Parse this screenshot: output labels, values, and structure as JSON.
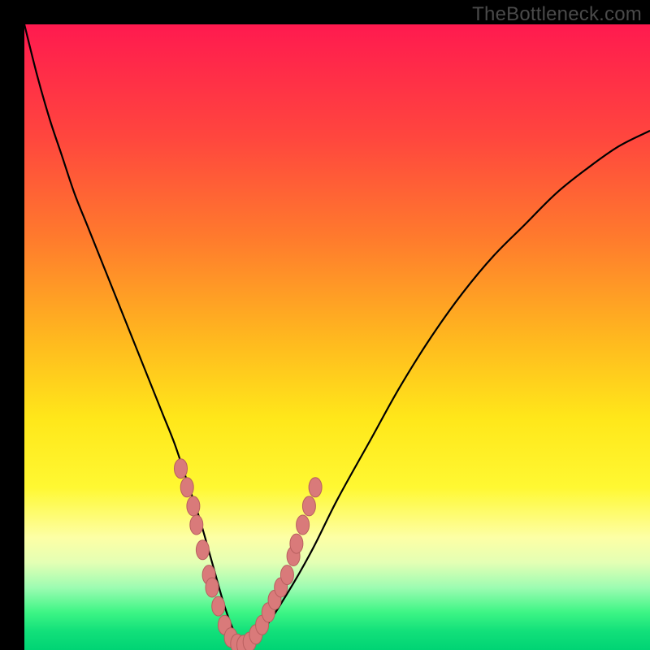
{
  "attribution": "TheBottleneck.com",
  "colors": {
    "frame": "#000000",
    "gradient_top": "#ff1a4f",
    "gradient_bottom": "#00d474",
    "curve_stroke": "#000000",
    "marker_fill": "#d97a7a",
    "marker_stroke": "#b85f5f"
  },
  "chart_data": {
    "type": "line",
    "title": "",
    "xlabel": "",
    "ylabel": "",
    "xlim": [
      0,
      100
    ],
    "ylim": [
      0,
      100
    ],
    "x": [
      0,
      2,
      4,
      6,
      8,
      10,
      12,
      14,
      16,
      18,
      20,
      22,
      24,
      26,
      28,
      30,
      32,
      33.5,
      35,
      38,
      42,
      46,
      50,
      55,
      60,
      65,
      70,
      75,
      80,
      85,
      90,
      95,
      100
    ],
    "y": [
      100,
      92,
      85,
      79,
      73,
      68,
      63,
      58,
      53,
      48,
      43,
      38,
      33,
      27,
      21,
      14,
      7,
      3,
      0.5,
      3,
      9,
      16,
      24,
      33,
      42,
      50,
      57,
      63,
      68,
      73,
      77,
      80.5,
      83
    ],
    "series": [
      {
        "name": "bottleneck-curve",
        "color": "#000000"
      }
    ],
    "markers": {
      "name": "highlighted-points",
      "color": "#d97a7a",
      "points": [
        {
          "x": 25,
          "y": 29
        },
        {
          "x": 26,
          "y": 26
        },
        {
          "x": 27,
          "y": 23
        },
        {
          "x": 27.5,
          "y": 20
        },
        {
          "x": 28.5,
          "y": 16
        },
        {
          "x": 29.5,
          "y": 12
        },
        {
          "x": 30,
          "y": 10
        },
        {
          "x": 31,
          "y": 7
        },
        {
          "x": 32,
          "y": 4
        },
        {
          "x": 33,
          "y": 2
        },
        {
          "x": 34,
          "y": 1
        },
        {
          "x": 35,
          "y": 0.8
        },
        {
          "x": 36,
          "y": 1.3
        },
        {
          "x": 37,
          "y": 2.5
        },
        {
          "x": 38,
          "y": 4
        },
        {
          "x": 39,
          "y": 6
        },
        {
          "x": 40,
          "y": 8
        },
        {
          "x": 41,
          "y": 10
        },
        {
          "x": 42,
          "y": 12
        },
        {
          "x": 43,
          "y": 15
        },
        {
          "x": 43.5,
          "y": 17
        },
        {
          "x": 44.5,
          "y": 20
        },
        {
          "x": 45.5,
          "y": 23
        },
        {
          "x": 46.5,
          "y": 26
        }
      ]
    }
  }
}
